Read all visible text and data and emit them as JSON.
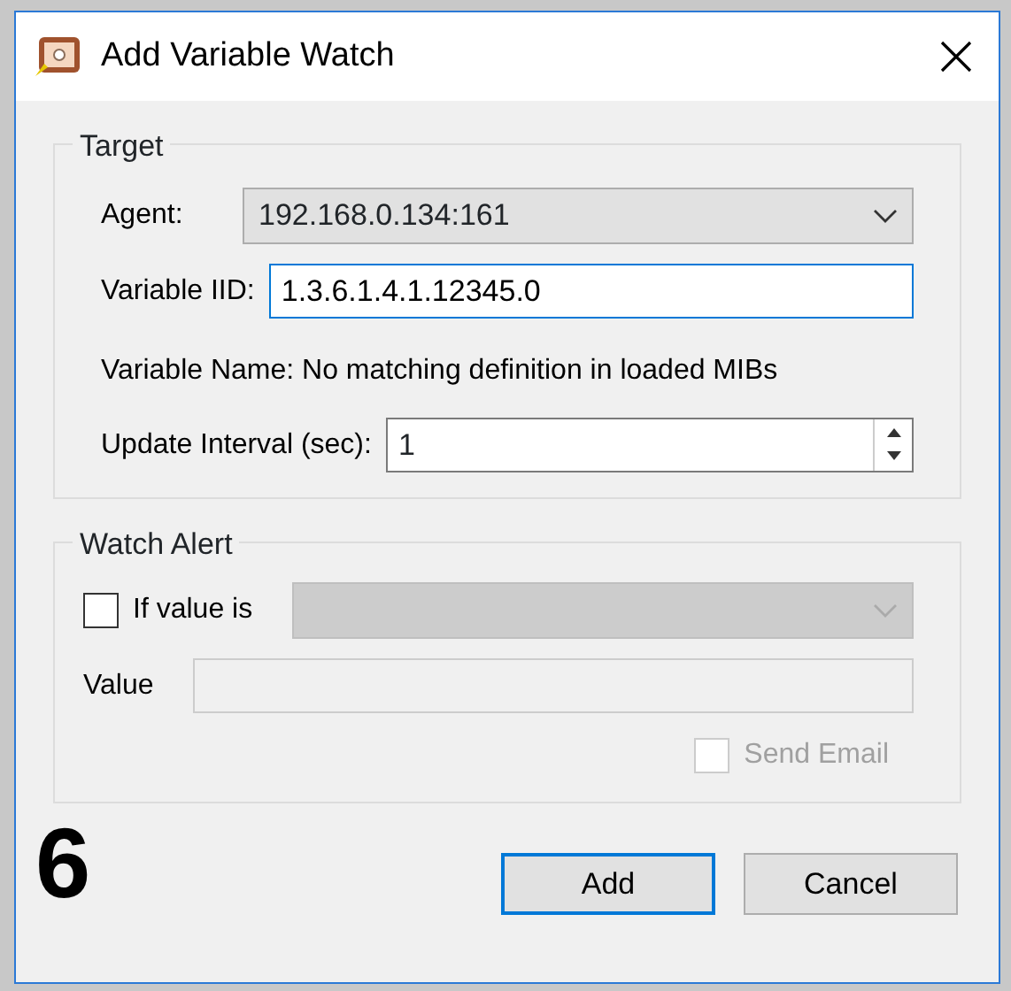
{
  "window": {
    "title": "Add Variable Watch"
  },
  "target": {
    "title": "Target",
    "agent": {
      "label": "Agent:",
      "value": "192.168.0.134:161"
    },
    "variable_iid": {
      "label": "Variable IID:",
      "value": "1.3.6.1.4.1.12345.0",
      "focused": true
    },
    "variable_name": "Variable Name: No matching definition in loaded MIBs",
    "update_interval": {
      "label": "Update Interval (sec):",
      "value": "1"
    }
  },
  "watch_alert": {
    "title": "Watch Alert",
    "condition": {
      "label": "If value is",
      "checked": false,
      "combo_disabled": true
    },
    "value": {
      "label": "Value",
      "disabled": true
    },
    "send_email": {
      "label": "Send Email",
      "checked": false,
      "disabled": true
    }
  },
  "buttons": [
    {
      "label": "Add",
      "default": true
    },
    {
      "label": "Cancel",
      "default": false
    }
  ],
  "step_number": "6"
}
